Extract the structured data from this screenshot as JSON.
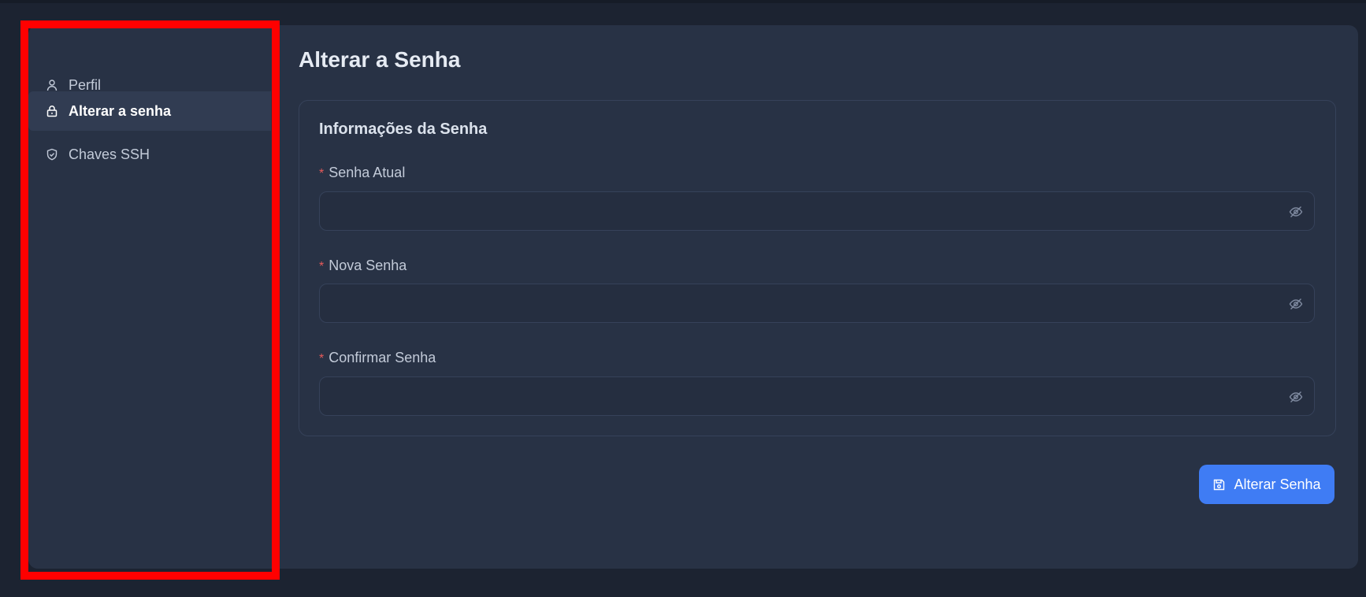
{
  "sidebar": {
    "items": [
      {
        "label": "Perfil",
        "icon": "user-icon",
        "active": false
      },
      {
        "label": "Alterar a senha",
        "icon": "lock-icon",
        "active": true
      },
      {
        "label": "Chaves SSH",
        "icon": "shield-check-icon",
        "active": false
      }
    ]
  },
  "main": {
    "title": "Alterar a Senha",
    "card_title": "Informações da Senha",
    "required_mark": "*",
    "fields": [
      {
        "label": "Senha Atual",
        "value": "",
        "placeholder": "",
        "toggle_icon": "eye-off-icon"
      },
      {
        "label": "Nova Senha",
        "value": "",
        "placeholder": "",
        "toggle_icon": "eye-off-icon"
      },
      {
        "label": "Confirmar Senha",
        "value": "",
        "placeholder": "",
        "toggle_icon": "eye-off-icon"
      }
    ],
    "submit_label": "Alterar Senha",
    "submit_icon": "save-icon"
  },
  "colors": {
    "background": "#1c2331",
    "panel": "#283245",
    "accent": "#3f7cf4",
    "required": "#e55a5a",
    "highlight_box": "#ff0000"
  }
}
